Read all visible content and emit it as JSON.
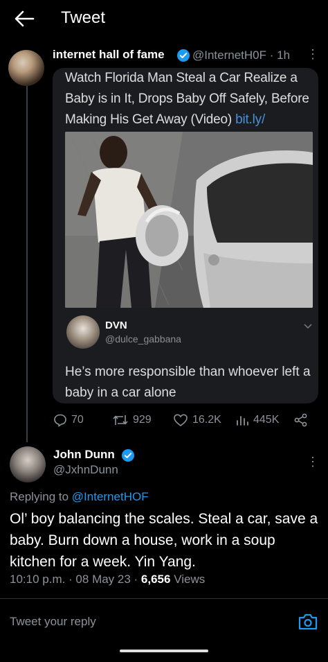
{
  "header": {
    "title": "Tweet"
  },
  "tweet": {
    "author_name": "internet hall of fame",
    "handle_time": "@InternetH0F · 1h",
    "more": "⋮",
    "embed": {
      "headline": "Watch Florida Man Steal a Car Realize a Baby is in It, Drops Baby Off Safely, Before Making His Get Away (Video) ",
      "link": "bit.ly/",
      "quoted": {
        "name": "DVN",
        "handle": "@dulce_gabbana",
        "text": "He’s more responsible than whoever left a baby in a car alone"
      }
    },
    "stats": {
      "replies": "70",
      "retweets": "929",
      "likes": "16.2K",
      "views": "445K"
    }
  },
  "reply": {
    "author_name": "John Dunn",
    "handle": "@JxhnDunn",
    "more": "⋮",
    "replying_prefix": "Replying to ",
    "replying_to": "@InternetHOF",
    "body": "Ol’ boy balancing the scales. Steal a car, save a baby. Burn down a house, work in a soup kitchen for a week. Yin Yang.",
    "time_date": "10:10 p.m. · 08 May 23 · ",
    "views_count": "6,656",
    "views_label": " Views"
  },
  "composer": {
    "placeholder": "Tweet your reply"
  },
  "colors": {
    "accent": "#1d9bf0",
    "background": "#000000",
    "muted": "#8b9399"
  }
}
